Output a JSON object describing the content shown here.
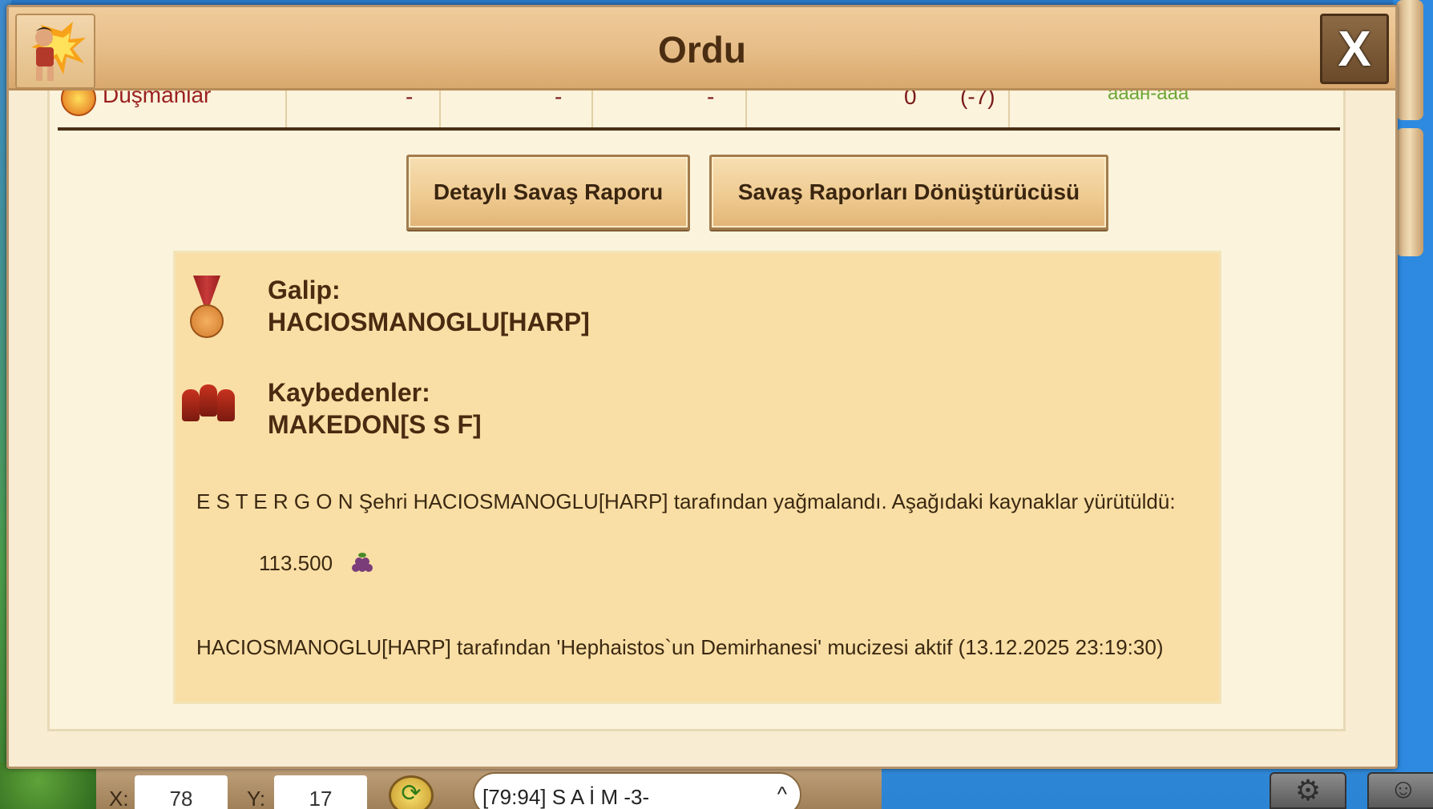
{
  "window": {
    "title": "Ordu",
    "close_label": "X"
  },
  "previous_row": {
    "label": "Düşmanlar",
    "cells": [
      "-",
      "-",
      "-",
      "0",
      "(-7)"
    ],
    "trailing": "ааан-ааа"
  },
  "buttons": {
    "detailed_report": "Detaylı Savaş Raporu",
    "report_converter": "Savaş Raporları Dönüştürücüsü"
  },
  "report": {
    "winner_heading": "Galip:",
    "winner_name": "HACIOSMANOGLU[HARP]",
    "loser_heading": "Kaybedenler:",
    "loser_name": "MAKEDON[S S F]",
    "loot_message": "E S T E R G O N Şehri HACIOSMANOGLU[HARP] tarafından yağmalandı. Aşağıdaki kaynaklar yürütüldü:",
    "loot_amount": "113.500",
    "loot_resource_icon": "grape-icon",
    "miracle_message": "HACIOSMANOGLU[HARP] tarafından 'Hephaistos`un Demirhanesi' mucizesi aktif (13.12.2025 23:19:30)"
  },
  "bottom_bar": {
    "x_label": "X:",
    "x_value": "78",
    "y_label": "Y:",
    "y_value": "17",
    "city_name": "[79:94] S A İ M -3-",
    "refresh_icon": "refresh-icon",
    "settings_icon": "gear-icon",
    "chat_icon": "chat-icon"
  },
  "colors": {
    "title_text": "#4b2e12",
    "report_bg": "#f9dfa5",
    "button_bg": "#efcb92",
    "enemy_red": "#9a1f1f"
  }
}
